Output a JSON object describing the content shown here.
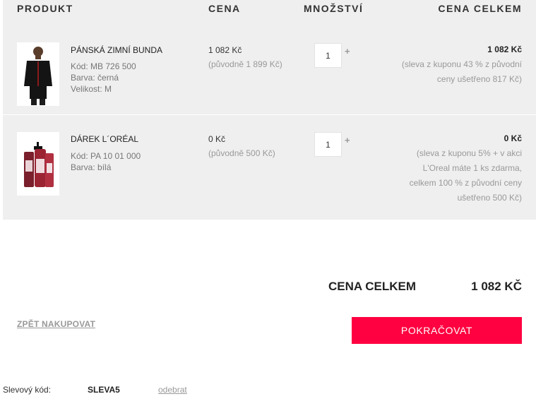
{
  "columns": {
    "product": "PRODUKT",
    "price": "CENA",
    "quantity": "MNOŽSTVÍ",
    "total": "CENA CELKEM"
  },
  "items": [
    {
      "name": "PÁNSKÁ ZIMNÍ BUNDA",
      "code": "Kód: MB 726 500",
      "color": "Barva: černá",
      "size": "Velikost: M",
      "price": "1 082 Kč",
      "original": "(původně 1 899 Kč)",
      "quantity": "1",
      "total": "1 082 Kč",
      "note": "(sleva z kuponu 43 % z původní ceny ušetřeno 817 Kč)"
    },
    {
      "name": "DÁREK L´ORÉAL",
      "code": "Kód: PA 10 01 000",
      "color": "Barva: bílá",
      "price": "0 Kč",
      "original": "(původně 500 Kč)",
      "quantity": "1",
      "total": "0 Kč",
      "note": "(sleva z kuponu 5% + v akci L'Oreal máte 1 ks zdarma, celkem 100 % z původní ceny ušetřeno 500 Kč)"
    }
  ],
  "plus_symbol": "+",
  "summary": {
    "label": "CENA CELKEM",
    "value": "1 082 KČ"
  },
  "back_link": "ZPĚT NAKUPOVAT",
  "continue_button": "POKRAČOVAT",
  "coupon": {
    "label": "Slevový kód:",
    "code": "SLEVA5",
    "remove": "odebrat"
  },
  "colors": {
    "accent": "#ff0040",
    "panel": "#efefef"
  }
}
